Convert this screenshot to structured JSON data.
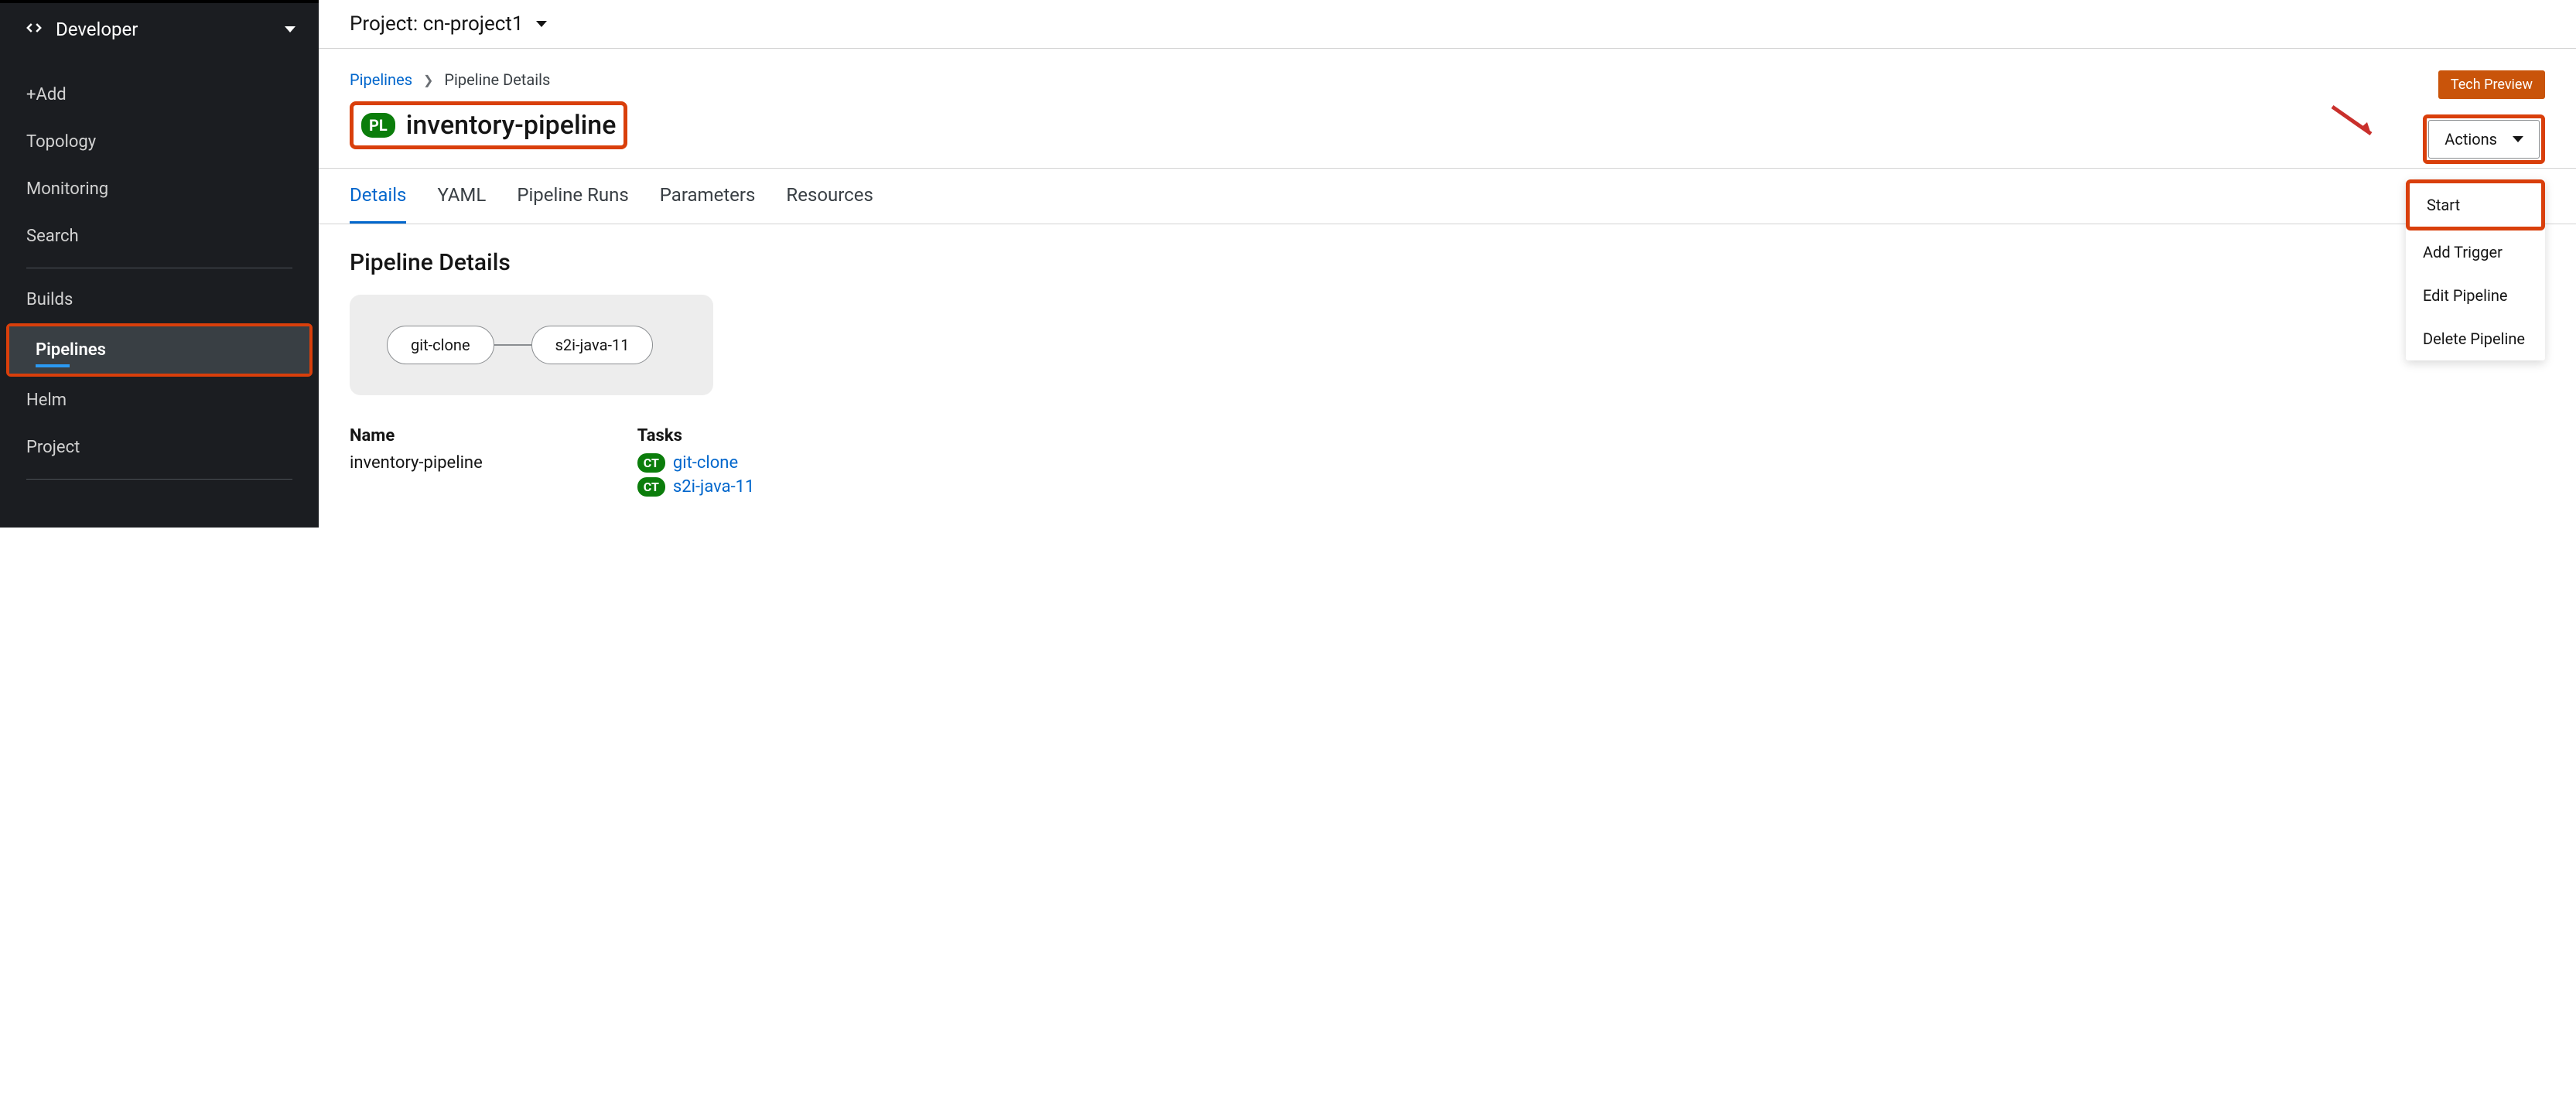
{
  "sidebar": {
    "perspective": "Developer",
    "items": [
      "+Add",
      "Topology",
      "Monitoring",
      "Search",
      "Builds",
      "Pipelines",
      "Helm",
      "Project"
    ]
  },
  "project": {
    "label": "Project: cn-project1"
  },
  "breadcrumb": {
    "root": "Pipelines",
    "current": "Pipeline Details"
  },
  "techPreview": "Tech Preview",
  "badge": "PL",
  "pipelineTitle": "inventory-pipeline",
  "actions": {
    "button": "Actions",
    "items": [
      "Start",
      "Add Trigger",
      "Edit Pipeline",
      "Delete Pipeline"
    ]
  },
  "tabs": [
    "Details",
    "YAML",
    "Pipeline Runs",
    "Parameters",
    "Resources"
  ],
  "sectionTitle": "Pipeline Details",
  "vizTasks": [
    "git-clone",
    "s2i-java-11"
  ],
  "details": {
    "nameLabel": "Name",
    "nameValue": "inventory-pipeline",
    "tasksLabel": "Tasks",
    "ctBadge": "CT",
    "taskLinks": [
      "git-clone",
      "s2i-java-11"
    ]
  }
}
